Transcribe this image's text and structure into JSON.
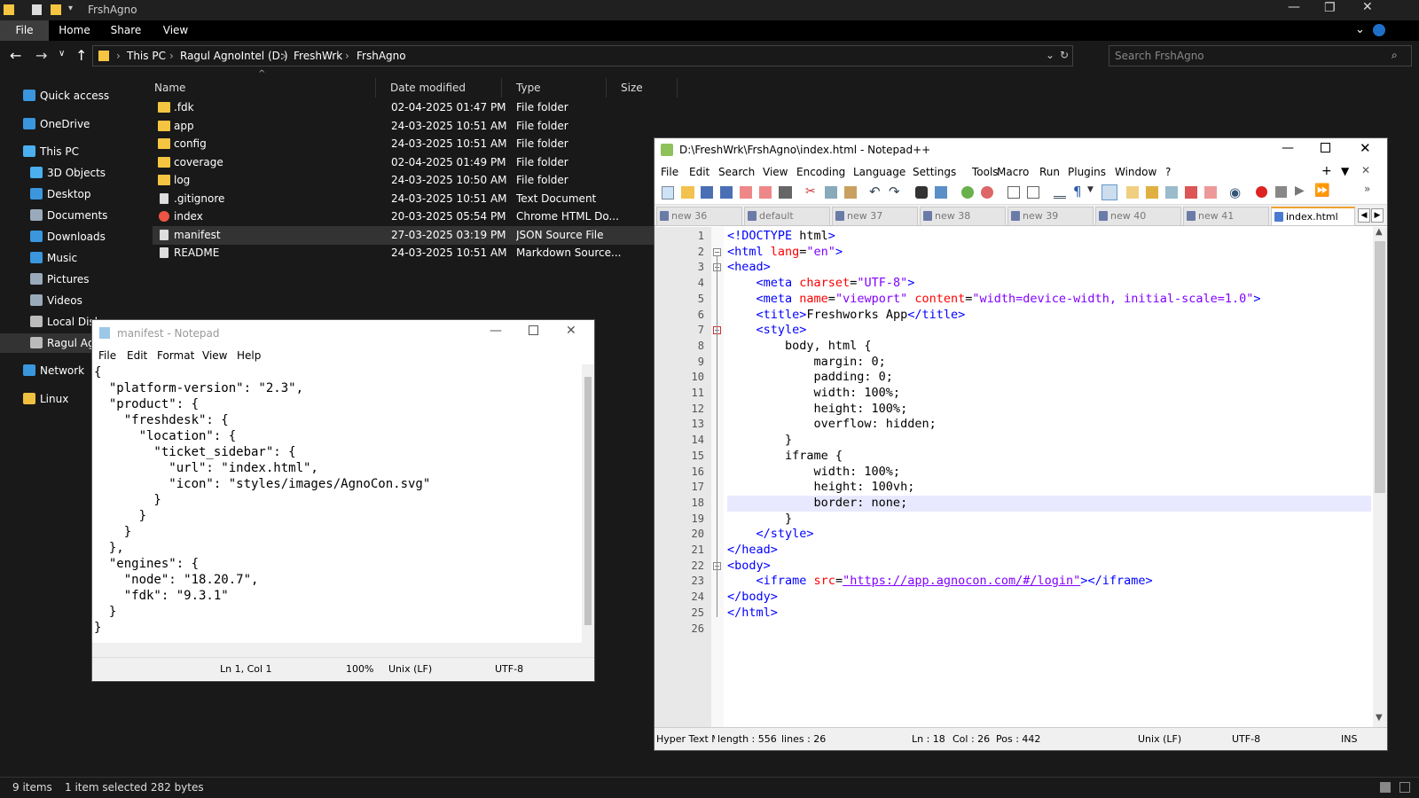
{
  "explorer": {
    "title": "FrshAgno",
    "ribbon": {
      "file": "File",
      "home": "Home",
      "share": "Share",
      "view": "View"
    },
    "breadcrumb": [
      "This PC",
      "Ragul AgnoIntel (D:)",
      "FreshWrk",
      "FrshAgno"
    ],
    "search_placeholder": "Search FrshAgno",
    "columns": {
      "name": "Name",
      "date": "Date modified",
      "type": "Type",
      "size": "Size"
    },
    "nav": [
      {
        "label": "Quick access",
        "icon": "star-icon",
        "color": "#3a96dd"
      },
      {
        "label": "OneDrive",
        "icon": "cloud-icon",
        "color": "#3a96dd"
      },
      {
        "label": "This PC",
        "icon": "computer-icon",
        "color": "#4ab0f0"
      },
      {
        "label": "3D Objects",
        "icon": "cube-icon",
        "color": "#4ab0f0"
      },
      {
        "label": "Desktop",
        "icon": "desktop-icon",
        "color": "#3a96dd"
      },
      {
        "label": "Documents",
        "icon": "document-icon",
        "color": "#9ab"
      },
      {
        "label": "Downloads",
        "icon": "download-icon",
        "color": "#3a96dd"
      },
      {
        "label": "Music",
        "icon": "music-icon",
        "color": "#3a96dd"
      },
      {
        "label": "Pictures",
        "icon": "picture-icon",
        "color": "#9ab"
      },
      {
        "label": "Videos",
        "icon": "video-icon",
        "color": "#9ab"
      },
      {
        "label": "Local Disk",
        "icon": "drive-icon",
        "color": "#bbb"
      },
      {
        "label": "Ragul Ag",
        "icon": "drive-icon",
        "color": "#bbb"
      },
      {
        "label": "Network",
        "icon": "network-icon",
        "color": "#3a96dd"
      },
      {
        "label": "Linux",
        "icon": "linux-icon",
        "color": "#f0c040"
      }
    ],
    "files": [
      {
        "name": ".fdk",
        "date": "02-04-2025 01:47 PM",
        "type": "File folder",
        "icon": "folder"
      },
      {
        "name": "app",
        "date": "24-03-2025 10:51 AM",
        "type": "File folder",
        "icon": "folder"
      },
      {
        "name": "config",
        "date": "24-03-2025 10:51 AM",
        "type": "File folder",
        "icon": "folder"
      },
      {
        "name": "coverage",
        "date": "02-04-2025 01:49 PM",
        "type": "File folder",
        "icon": "folder"
      },
      {
        "name": "log",
        "date": "24-03-2025 10:50 AM",
        "type": "File folder",
        "icon": "folder"
      },
      {
        "name": ".gitignore",
        "date": "24-03-2025 10:51 AM",
        "type": "Text Document",
        "icon": "file"
      },
      {
        "name": "index",
        "date": "20-03-2025 05:54 PM",
        "type": "Chrome HTML Do...",
        "icon": "chrome"
      },
      {
        "name": "manifest",
        "date": "27-03-2025 03:19 PM",
        "type": "JSON Source File",
        "icon": "file"
      },
      {
        "name": "README",
        "date": "24-03-2025 10:51 AM",
        "type": "Markdown Source...",
        "icon": "file"
      }
    ],
    "status": {
      "items": "9 items",
      "selected": "1 item selected  282 bytes"
    }
  },
  "notepad": {
    "title": "manifest - Notepad",
    "menu": [
      "File",
      "Edit",
      "Format",
      "View",
      "Help"
    ],
    "lines": [
      "{",
      "  \"platform-version\": \"2.3\",",
      "  \"product\": {",
      "    \"freshdesk\": {",
      "      \"location\": {",
      "        \"ticket_sidebar\": {",
      "          \"url\": \"index.html\",",
      "          \"icon\": \"styles/images/AgnoCon.svg\"",
      "        }",
      "      }",
      "    }",
      "  },",
      "  \"engines\": {",
      "    \"node\": \"18.20.7\",",
      "    \"fdk\": \"9.3.1\"",
      "  }",
      "}"
    ],
    "status": {
      "pos": "Ln 1, Col 1",
      "zoom": "100%",
      "eol": "Unix (LF)",
      "enc": "UTF-8"
    }
  },
  "npp": {
    "title": "D:\\FreshWrk\\FrshAgno\\index.html - Notepad++",
    "menu": [
      "File",
      "Edit",
      "Search",
      "View",
      "Encoding",
      "Language",
      "Settings",
      "Tools",
      "Macro",
      "Run",
      "Plugins",
      "Window",
      "?"
    ],
    "tabs": [
      "new 36",
      "default",
      "new 37",
      "new 38",
      "new 39",
      "new 40",
      "new 41",
      "index.html"
    ],
    "code": [
      "<!DOCTYPE html>",
      "<html lang=\"en\">",
      "<head>",
      "    <meta charset=\"UTF-8\">",
      "    <meta name=\"viewport\" content=\"width=device-width, initial-scale=1.0\">",
      "    <title>Freshworks App</title>",
      "    <style>",
      "        body, html {",
      "            margin: 0;",
      "            padding: 0;",
      "            width: 100%;",
      "            height: 100%;",
      "            overflow: hidden;",
      "        }",
      "        iframe {",
      "            width: 100%;",
      "            height: 100vh;",
      "            border: none;",
      "        }",
      "    </style>",
      "</head>",
      "<body>",
      "    <iframe src=\"https://app.agnocon.com/#/login\"></iframe>",
      "</body>",
      "</html>",
      ""
    ],
    "current_line": 18,
    "status": {
      "lang": "Hyper Text M",
      "length": "length : 556",
      "lines": "lines : 26",
      "ln": "Ln : 18",
      "col": "Col : 26",
      "pos": "Pos : 442",
      "eol": "Unix (LF)",
      "enc": "UTF-8",
      "ins": "INS"
    }
  }
}
